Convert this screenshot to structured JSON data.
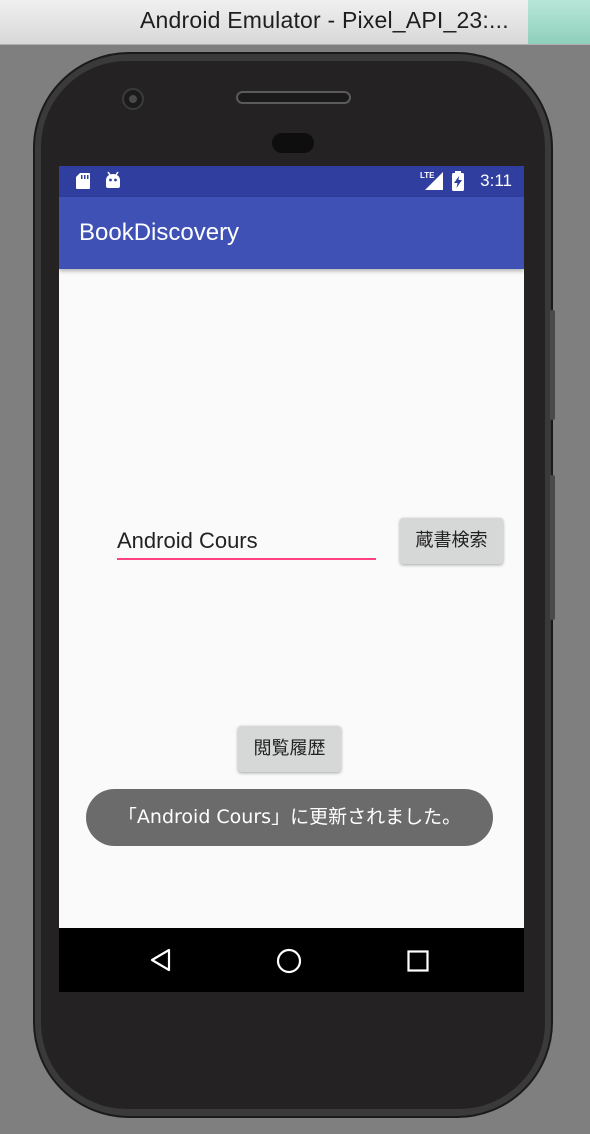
{
  "window": {
    "title": "Android Emulator - Pixel_API_23:..."
  },
  "statusbar": {
    "time": "3:11",
    "network_label": "LTE",
    "icons": [
      "sd-card-icon",
      "android-debug-icon",
      "lte-signal-icon",
      "battery-charging-icon"
    ]
  },
  "app": {
    "title": "BookDiscovery"
  },
  "search": {
    "value": "Android Cours",
    "button_label": "蔵書検索"
  },
  "history": {
    "button_label": "閲覧履歴"
  },
  "toast": {
    "message": "「Android Cours」に更新されました。"
  },
  "navbar": {
    "icons": [
      "back-icon",
      "home-icon",
      "recents-icon"
    ]
  },
  "colors": {
    "statusbar": "#303f9f",
    "appbar": "#3f51b5",
    "accent": "#ff4081",
    "screen_bg": "#fafafa",
    "toast_bg": "#6b6b6b"
  }
}
